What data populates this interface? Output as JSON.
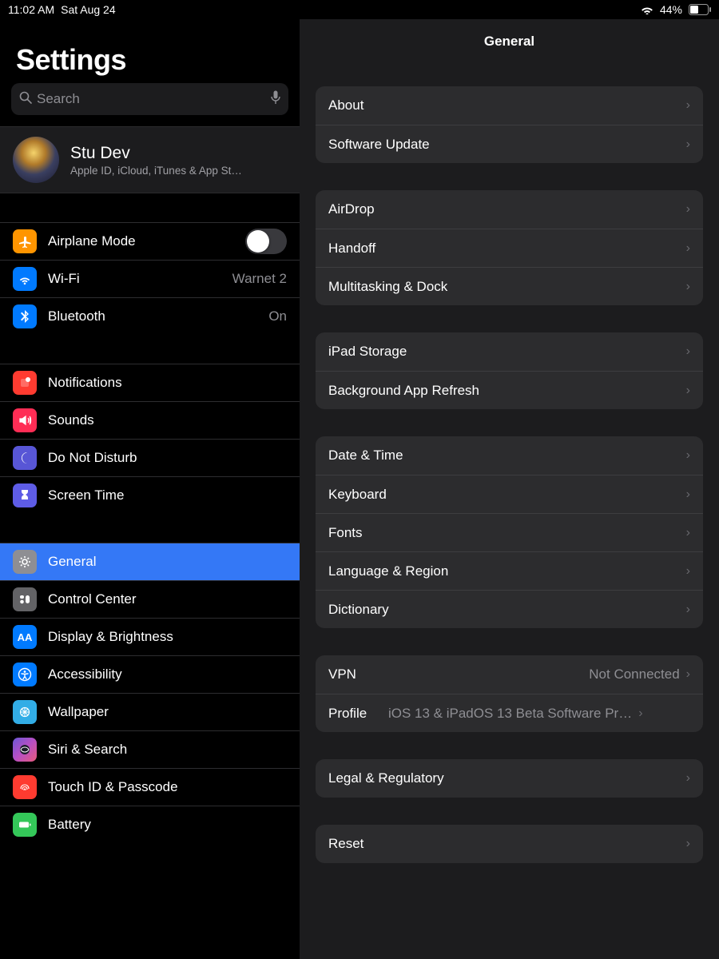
{
  "statusbar": {
    "time": "11:02 AM",
    "date": "Sat Aug 24",
    "battery_pct": "44%"
  },
  "sidebar": {
    "title": "Settings",
    "search_placeholder": "Search",
    "profile": {
      "name": "Stu Dev",
      "subtitle": "Apple ID, iCloud, iTunes & App St…"
    },
    "g1": {
      "airplane": "Airplane Mode",
      "wifi": "Wi-Fi",
      "wifi_value": "Warnet 2",
      "bluetooth": "Bluetooth",
      "bluetooth_value": "On"
    },
    "g2": {
      "notifications": "Notifications",
      "sounds": "Sounds",
      "dnd": "Do Not Disturb",
      "screentime": "Screen Time"
    },
    "g3": {
      "general": "General",
      "control_center": "Control Center",
      "display": "Display & Brightness",
      "accessibility": "Accessibility",
      "wallpaper": "Wallpaper",
      "siri": "Siri & Search",
      "touchid": "Touch ID & Passcode",
      "battery": "Battery"
    }
  },
  "detail": {
    "title": "General",
    "g1": {
      "about": "About",
      "software_update": "Software Update"
    },
    "g2": {
      "airdrop": "AirDrop",
      "handoff": "Handoff",
      "multitasking": "Multitasking & Dock"
    },
    "g3": {
      "storage": "iPad Storage",
      "bg_refresh": "Background App Refresh"
    },
    "g4": {
      "date_time": "Date & Time",
      "keyboard": "Keyboard",
      "fonts": "Fonts",
      "language": "Language & Region",
      "dictionary": "Dictionary"
    },
    "g5": {
      "vpn": "VPN",
      "vpn_value": "Not Connected",
      "profile": "Profile",
      "profile_value": "iOS 13 & iPadOS 13 Beta Software Pr…"
    },
    "g6": {
      "legal": "Legal & Regulatory"
    },
    "g7": {
      "reset": "Reset"
    }
  }
}
